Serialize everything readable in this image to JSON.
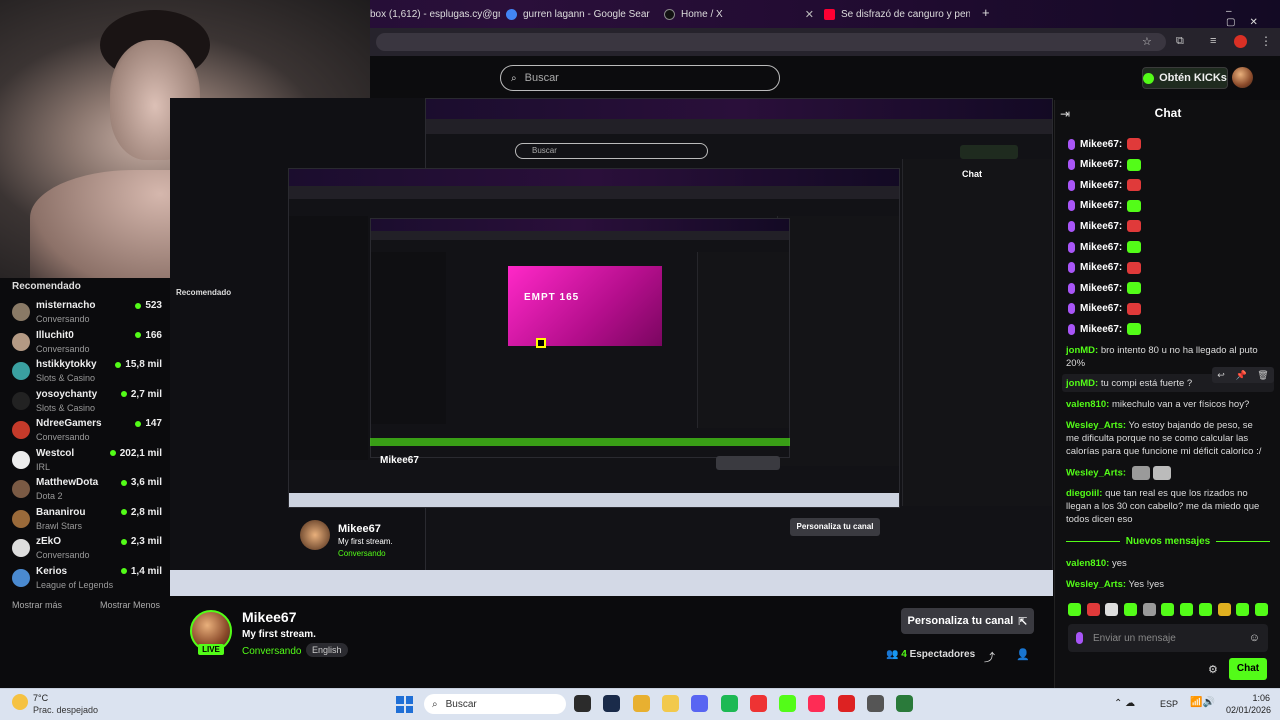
{
  "browser": {
    "tabs": [
      {
        "label": "box (1,612) - esplugas.cy@gm",
        "color": "#d93025"
      },
      {
        "label": "gurren lagann - Google Search",
        "color": "#4285f4"
      },
      {
        "label": "Home / X",
        "color": "#111111"
      },
      {
        "label": "Se disfrazó de canguro y pensó",
        "color": "#ff0033"
      }
    ],
    "new_tab": "+"
  },
  "header": {
    "search_placeholder": "Buscar",
    "kicks_label": "Obtén KICKs"
  },
  "sidebar": {
    "title": "Recomendado",
    "channels": [
      {
        "name": "misternacho",
        "category": "Conversando",
        "viewers": "523",
        "color": "#8a7a66"
      },
      {
        "name": "Illuchit0",
        "category": "Conversando",
        "viewers": "166",
        "color": "#b49a84"
      },
      {
        "name": "hstikkytokky",
        "category": "Slots & Casino",
        "viewers": "15,8 mil",
        "color": "#3aa0a0"
      },
      {
        "name": "yosoychanty",
        "category": "Slots & Casino",
        "viewers": "2,7 mil",
        "color": "#222222"
      },
      {
        "name": "NdreeGamers",
        "category": "Conversando",
        "viewers": "147",
        "color": "#c43a2a"
      },
      {
        "name": "Westcol",
        "category": "IRL",
        "viewers": "202,1 mil",
        "color": "#eeeeee"
      },
      {
        "name": "MatthewDota",
        "category": "Dota 2",
        "viewers": "3,6 mil",
        "color": "#7a5a44"
      },
      {
        "name": "Bananirou",
        "category": "Brawl Stars",
        "viewers": "2,8 mil",
        "color": "#9a6a3a"
      },
      {
        "name": "zEkO",
        "category": "Conversando",
        "viewers": "2,3 mil",
        "color": "#dddddd"
      },
      {
        "name": "Kerios",
        "category": "League of Legends",
        "viewers": "1,4 mil",
        "color": "#4a8ad0"
      }
    ],
    "show_more": "Mostrar más",
    "show_less": "Mostrar Menos"
  },
  "stream": {
    "streamer": "Mikee67",
    "title": "My first stream.",
    "category": "Conversando",
    "language": "English",
    "live_badge": "LIVE",
    "customize_button": "Personaliza tu canal",
    "viewers_count": "4",
    "viewers_label": "Espectadores",
    "nested_game_text": "EMPT 165"
  },
  "chat": {
    "title": "Chat",
    "emote_rows": [
      {
        "user": "Mikee67:",
        "emote": "#e03a3a"
      },
      {
        "user": "Mikee67:",
        "emote": "#53fc18"
      },
      {
        "user": "Mikee67:",
        "emote": "#e03a3a"
      },
      {
        "user": "Mikee67:",
        "emote": "#53fc18"
      },
      {
        "user": "Mikee67:",
        "emote": "#e03a3a"
      },
      {
        "user": "Mikee67:",
        "emote": "#53fc18"
      },
      {
        "user": "Mikee67:",
        "emote": "#e03a3a"
      },
      {
        "user": "Mikee67:",
        "emote": "#53fc18"
      },
      {
        "user": "Mikee67:",
        "emote": "#e03a3a"
      },
      {
        "user": "Mikee67:",
        "emote": "#53fc18"
      }
    ],
    "messages": [
      {
        "user": "jonMD:",
        "text": "bro intento 80 u no ha llegado al puto 20%"
      },
      {
        "user": "jonMD:",
        "text": "tu compi está fuerte ?"
      },
      {
        "user": "valen810:",
        "text": "mikechulo van a ver físicos hoy?"
      },
      {
        "user": "Wesley_Arts:",
        "text": "Yo estoy bajando de peso, se me dificulta porque no se como calcular las calorías para que funcione mi déficit calorico :/"
      },
      {
        "user": "Wesley_Arts:",
        "text": ""
      },
      {
        "user": "diegoiil:",
        "text": "que tan real es que los rizados no llegan a los 30 con cabello? me da miedo que todos dicen eso"
      }
    ],
    "new_messages_label": "Nuevos mensajes",
    "new_messages": [
      {
        "user": "valen810:",
        "text": "yes"
      },
      {
        "user": "Wesley_Arts:",
        "text": "Yes !yes"
      }
    ],
    "input_placeholder": "Enviar un mensaje",
    "send_label": "Chat",
    "emote_bar_colors": [
      "#53fc18",
      "#e03a3a",
      "#dddddd",
      "#53fc18",
      "#9a9a9a",
      "#53fc18",
      "#53fc18",
      "#53fc18",
      "#e0b020",
      "#53fc18",
      "#53fc18"
    ]
  },
  "taskbar": {
    "temp": "7°C",
    "weather": "Prac. despejado",
    "search_label": "Buscar",
    "language": "ESP",
    "time": "1:06",
    "date": "02/01/2026",
    "apps": [
      "#2b2b2b",
      "#1a2b4a",
      "#e8b030",
      "#f2c94c",
      "#5865f2",
      "#1db954",
      "#e33",
      "#53fc18",
      "#fe2c55",
      "#d22",
      "#555",
      "#2a7a3a"
    ]
  },
  "colors": {
    "accent": "#53fc18",
    "background": "#0b0b0d",
    "chat_username": "#53fc18"
  }
}
